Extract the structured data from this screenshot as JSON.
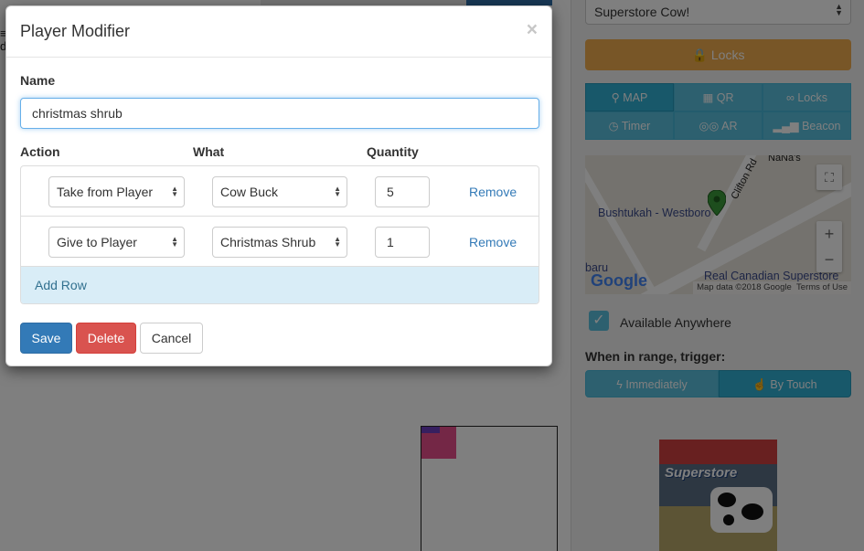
{
  "background": {
    "right_panel": {
      "location_select": "Superstore Cow!",
      "locks_button": "Locks",
      "tabs": [
        {
          "label": "MAP",
          "icon": "map-marker-icon"
        },
        {
          "label": "QR",
          "icon": "qrcode-icon"
        },
        {
          "label": "Locks",
          "icon": "link-icon"
        },
        {
          "label": "Timer",
          "icon": "clock-icon"
        },
        {
          "label": "AR",
          "icon": "glasses-icon"
        },
        {
          "label": "Beacon",
          "icon": "signal-icon"
        }
      ],
      "map": {
        "labels": [
          "Bushtukah - Westboro",
          "Real Canadian Superstore",
          "NaNa's",
          "Clifton Rd",
          "baru"
        ],
        "google_logo": "Google",
        "attribution": "Map data ©2018 Google",
        "terms": "Terms of Use"
      },
      "available_anywhere": "Available Anywhere",
      "trigger_label": "When in range, trigger:",
      "trigger_options": [
        "Immediately",
        "By Touch"
      ],
      "photo_sign": "Superstore"
    }
  },
  "modal": {
    "title": "Player Modifier",
    "close_symbol": "×",
    "name_label": "Name",
    "name_value": "christmas shrub",
    "columns": {
      "action": "Action",
      "what": "What",
      "quantity": "Quantity"
    },
    "rows": [
      {
        "action": "Take from Player",
        "what": "Cow Buck",
        "quantity": "5",
        "remove": "Remove"
      },
      {
        "action": "Give to Player",
        "what": "Christmas Shrub",
        "quantity": "1",
        "remove": "Remove"
      }
    ],
    "add_row": "Add Row",
    "buttons": {
      "save": "Save",
      "delete": "Delete",
      "cancel": "Cancel"
    }
  }
}
